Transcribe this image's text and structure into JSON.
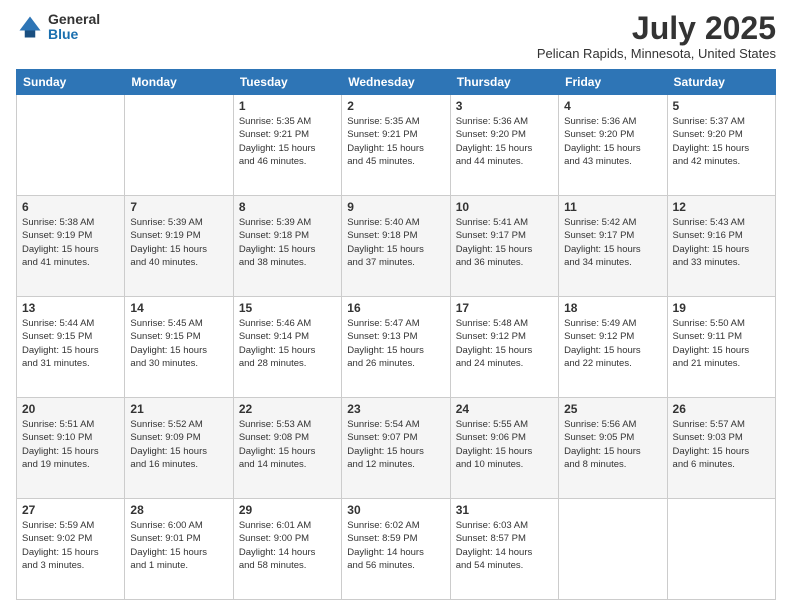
{
  "logo": {
    "general": "General",
    "blue": "Blue"
  },
  "header": {
    "month_year": "July 2025",
    "location": "Pelican Rapids, Minnesota, United States"
  },
  "days_of_week": [
    "Sunday",
    "Monday",
    "Tuesday",
    "Wednesday",
    "Thursday",
    "Friday",
    "Saturday"
  ],
  "weeks": [
    [
      {
        "day": "",
        "info": ""
      },
      {
        "day": "",
        "info": ""
      },
      {
        "day": "1",
        "info": "Sunrise: 5:35 AM\nSunset: 9:21 PM\nDaylight: 15 hours\nand 46 minutes."
      },
      {
        "day": "2",
        "info": "Sunrise: 5:35 AM\nSunset: 9:21 PM\nDaylight: 15 hours\nand 45 minutes."
      },
      {
        "day": "3",
        "info": "Sunrise: 5:36 AM\nSunset: 9:20 PM\nDaylight: 15 hours\nand 44 minutes."
      },
      {
        "day": "4",
        "info": "Sunrise: 5:36 AM\nSunset: 9:20 PM\nDaylight: 15 hours\nand 43 minutes."
      },
      {
        "day": "5",
        "info": "Sunrise: 5:37 AM\nSunset: 9:20 PM\nDaylight: 15 hours\nand 42 minutes."
      }
    ],
    [
      {
        "day": "6",
        "info": "Sunrise: 5:38 AM\nSunset: 9:19 PM\nDaylight: 15 hours\nand 41 minutes."
      },
      {
        "day": "7",
        "info": "Sunrise: 5:39 AM\nSunset: 9:19 PM\nDaylight: 15 hours\nand 40 minutes."
      },
      {
        "day": "8",
        "info": "Sunrise: 5:39 AM\nSunset: 9:18 PM\nDaylight: 15 hours\nand 38 minutes."
      },
      {
        "day": "9",
        "info": "Sunrise: 5:40 AM\nSunset: 9:18 PM\nDaylight: 15 hours\nand 37 minutes."
      },
      {
        "day": "10",
        "info": "Sunrise: 5:41 AM\nSunset: 9:17 PM\nDaylight: 15 hours\nand 36 minutes."
      },
      {
        "day": "11",
        "info": "Sunrise: 5:42 AM\nSunset: 9:17 PM\nDaylight: 15 hours\nand 34 minutes."
      },
      {
        "day": "12",
        "info": "Sunrise: 5:43 AM\nSunset: 9:16 PM\nDaylight: 15 hours\nand 33 minutes."
      }
    ],
    [
      {
        "day": "13",
        "info": "Sunrise: 5:44 AM\nSunset: 9:15 PM\nDaylight: 15 hours\nand 31 minutes."
      },
      {
        "day": "14",
        "info": "Sunrise: 5:45 AM\nSunset: 9:15 PM\nDaylight: 15 hours\nand 30 minutes."
      },
      {
        "day": "15",
        "info": "Sunrise: 5:46 AM\nSunset: 9:14 PM\nDaylight: 15 hours\nand 28 minutes."
      },
      {
        "day": "16",
        "info": "Sunrise: 5:47 AM\nSunset: 9:13 PM\nDaylight: 15 hours\nand 26 minutes."
      },
      {
        "day": "17",
        "info": "Sunrise: 5:48 AM\nSunset: 9:12 PM\nDaylight: 15 hours\nand 24 minutes."
      },
      {
        "day": "18",
        "info": "Sunrise: 5:49 AM\nSunset: 9:12 PM\nDaylight: 15 hours\nand 22 minutes."
      },
      {
        "day": "19",
        "info": "Sunrise: 5:50 AM\nSunset: 9:11 PM\nDaylight: 15 hours\nand 21 minutes."
      }
    ],
    [
      {
        "day": "20",
        "info": "Sunrise: 5:51 AM\nSunset: 9:10 PM\nDaylight: 15 hours\nand 19 minutes."
      },
      {
        "day": "21",
        "info": "Sunrise: 5:52 AM\nSunset: 9:09 PM\nDaylight: 15 hours\nand 16 minutes."
      },
      {
        "day": "22",
        "info": "Sunrise: 5:53 AM\nSunset: 9:08 PM\nDaylight: 15 hours\nand 14 minutes."
      },
      {
        "day": "23",
        "info": "Sunrise: 5:54 AM\nSunset: 9:07 PM\nDaylight: 15 hours\nand 12 minutes."
      },
      {
        "day": "24",
        "info": "Sunrise: 5:55 AM\nSunset: 9:06 PM\nDaylight: 15 hours\nand 10 minutes."
      },
      {
        "day": "25",
        "info": "Sunrise: 5:56 AM\nSunset: 9:05 PM\nDaylight: 15 hours\nand 8 minutes."
      },
      {
        "day": "26",
        "info": "Sunrise: 5:57 AM\nSunset: 9:03 PM\nDaylight: 15 hours\nand 6 minutes."
      }
    ],
    [
      {
        "day": "27",
        "info": "Sunrise: 5:59 AM\nSunset: 9:02 PM\nDaylight: 15 hours\nand 3 minutes."
      },
      {
        "day": "28",
        "info": "Sunrise: 6:00 AM\nSunset: 9:01 PM\nDaylight: 15 hours\nand 1 minute."
      },
      {
        "day": "29",
        "info": "Sunrise: 6:01 AM\nSunset: 9:00 PM\nDaylight: 14 hours\nand 58 minutes."
      },
      {
        "day": "30",
        "info": "Sunrise: 6:02 AM\nSunset: 8:59 PM\nDaylight: 14 hours\nand 56 minutes."
      },
      {
        "day": "31",
        "info": "Sunrise: 6:03 AM\nSunset: 8:57 PM\nDaylight: 14 hours\nand 54 minutes."
      },
      {
        "day": "",
        "info": ""
      },
      {
        "day": "",
        "info": ""
      }
    ]
  ]
}
